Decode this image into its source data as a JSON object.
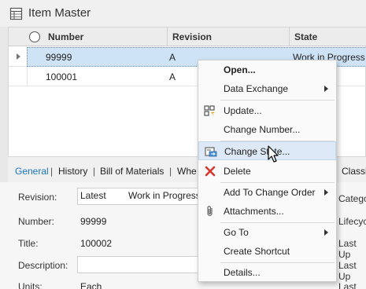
{
  "window": {
    "title": "Item Master",
    "icon": "table-icon"
  },
  "grid": {
    "columns": [
      "Number",
      "Revision",
      "State"
    ],
    "rows": [
      {
        "number": "99999",
        "revision": "A",
        "state": "Work in Progress",
        "selected": true
      },
      {
        "number": "100001",
        "revision": "A",
        "state": "",
        "selected": false
      }
    ]
  },
  "tabs": {
    "items": [
      "General",
      "History",
      "Bill of Materials",
      "Whe",
      "Classi"
    ],
    "separator": "|",
    "active": "General"
  },
  "form": {
    "revision_label": "Revision:",
    "revision_value": "Latest",
    "revision_state": "Work in Progress",
    "number_label": "Number:",
    "number_value": "99999",
    "title_label": "Title:",
    "title_value": "100002",
    "description_label": "Description:",
    "description_value": "",
    "units_label": "Units:",
    "units_value": "Each",
    "right_labels": [
      "Catego",
      "Lifecyc",
      "Last Up",
      "Last Up",
      "Last Up"
    ]
  },
  "context_menu": {
    "items": {
      "open": "Open...",
      "data_exchange": "Data Exchange",
      "update": "Update...",
      "change_number": "Change Number...",
      "change_state": "Change State...",
      "delete": "Delete",
      "add_to_change_order": "Add To Change Order",
      "attachments": "Attachments...",
      "go_to": "Go To",
      "create_shortcut": "Create Shortcut",
      "details": "Details..."
    },
    "hovered": "change_state"
  },
  "colors": {
    "accent": "#1a73c2",
    "selection": "#cfe3f7",
    "delete_red": "#d9362b",
    "menu_hover": "#dde9f6"
  }
}
